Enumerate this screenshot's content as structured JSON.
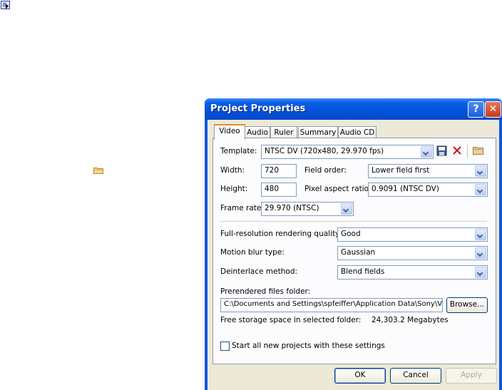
{
  "desktop": {
    "corner_icon": "app-icon",
    "folder_icon": "folder-icon"
  },
  "window": {
    "title": "Project Properties",
    "help_label": "?",
    "close_label": "✕"
  },
  "tabs": [
    {
      "label": "Video"
    },
    {
      "label": "Audio"
    },
    {
      "label": "Ruler"
    },
    {
      "label": "Summary"
    },
    {
      "label": "Audio CD"
    }
  ],
  "video": {
    "template_label": "Template:",
    "template_value": "NTSC DV (720x480, 29.970 fps)",
    "width_label": "Width:",
    "width_value": "720",
    "height_label": "Height:",
    "height_value": "480",
    "field_order_label": "Field order:",
    "field_order_value": "Lower field first",
    "pixel_aspect_label": "Pixel aspect ratio:",
    "pixel_aspect_value": "0.9091 (NTSC DV)",
    "frame_rate_label": "Frame rate:",
    "frame_rate_value": "29.970 (NTSC)",
    "render_quality_label": "Full-resolution rendering quality:",
    "render_quality_value": "Good",
    "motion_blur_label": "Motion blur type:",
    "motion_blur_value": "Gaussian",
    "deinterlace_label": "Deinterlace method:",
    "deinterlace_value": "Blend fields",
    "prerender_label": "Prerendered files folder:",
    "prerender_path": "C:\\Documents and Settings\\spfeiffer\\Application Data\\Sony\\Vegas",
    "browse_label": "Browse...",
    "free_space_label": "Free storage space in selected folder:",
    "free_space_value": "24,303.2 Megabytes",
    "start_all_label": "Start all new projects with these settings",
    "start_all_checked": false
  },
  "buttons": {
    "ok": "OK",
    "cancel": "Cancel",
    "apply": "Apply"
  },
  "colors": {
    "title_bar": "#0551d9",
    "dialog_bg": "#ece9d8",
    "active_tab_accent": "#e68b2c",
    "close": "#c6391b"
  }
}
